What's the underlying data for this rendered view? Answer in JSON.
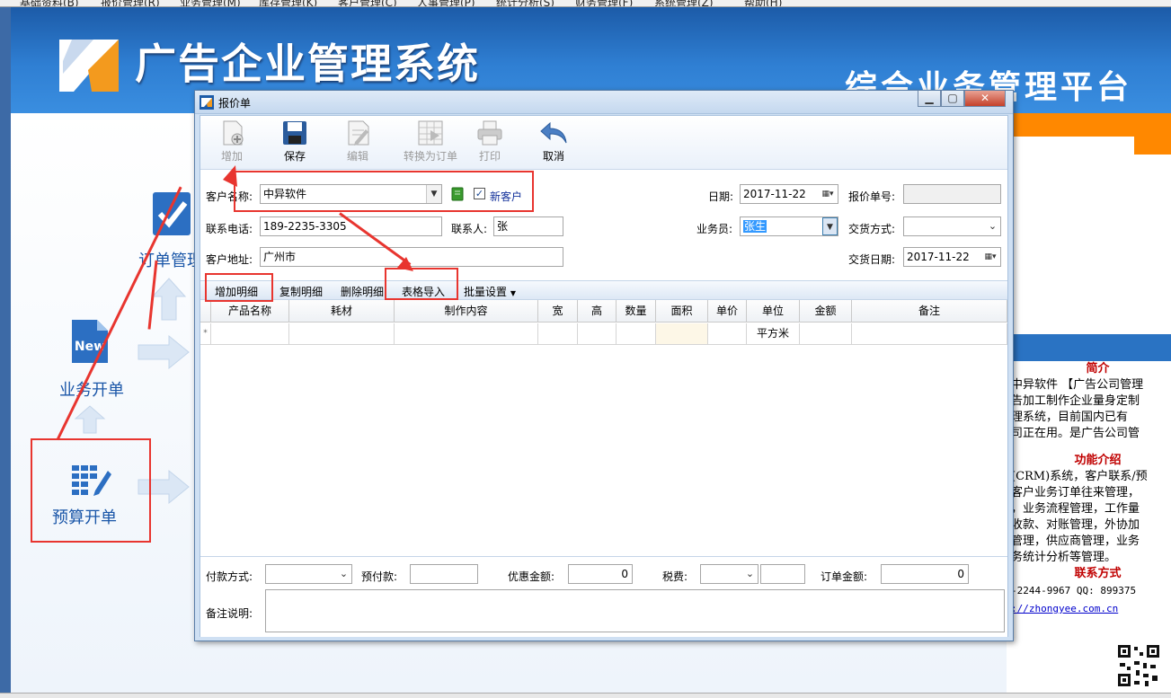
{
  "menu": [
    "基础资料(B)",
    "报价管理(R)",
    "业务管理(M)",
    "库存管理(K)",
    "客户管理(C)",
    "人事管理(P)",
    "统计分析(S)",
    "财务管理(F)",
    "系统管理(Z)",
    "帮助(H)"
  ],
  "banner": {
    "title": "广告企业管理系统",
    "subtitle": "综合业务管理平台"
  },
  "flow": {
    "order_label": "订单管理",
    "business_label": "业务开单",
    "budget_label": "预算开单",
    "new_badge": "New"
  },
  "right_panel": {
    "intro_heading": "简介",
    "intro_lines": [
      "中异软件 【广告公司管理",
      "告加工制作企业量身定制",
      "理系统，目前国内已有",
      "司正在用。是广告公司管"
    ],
    "func_heading": "功能介绍",
    "func_lines": [
      "(CRM)系统，客户联系/预",
      "客户业务订单往来管理，",
      "，业务流程管理，工作量",
      "收款、对账管理，外协加",
      "管理，供应商管理，业务",
      "务统计分析等管理。"
    ],
    "contact_heading": "联系方式",
    "contact_lines": [
      "-2244-9967  QQ: 899375",
      "://zhongyee.com.cn"
    ]
  },
  "dialog": {
    "title": "报价单",
    "toolbar": {
      "add": "增加",
      "save": "保存",
      "edit": "编辑",
      "convert": "转换为订单",
      "print": "打印",
      "cancel": "取消"
    },
    "form": {
      "customer_name_label": "客户名称:",
      "customer_name": "中异软件",
      "new_customer_label": "新客户",
      "new_customer_checked": true,
      "phone_label": "联系电话:",
      "phone": "189-2235-3305",
      "contact_label": "联系人:",
      "contact": "张",
      "address_label": "客户地址:",
      "address": "广州市",
      "date_label": "日期:",
      "date": "2017-11-22",
      "quote_no_label": "报价单号:",
      "quote_no": "",
      "salesman_label": "业务员:",
      "salesman": "张生",
      "delivery_method_label": "交货方式:",
      "delivery_method": "",
      "delivery_date_label": "交货日期:",
      "delivery_date": "2017-11-22"
    },
    "tabs": {
      "add_detail": "增加明细",
      "copy_detail": "复制明细",
      "delete_detail": "删除明细",
      "table_import": "表格导入",
      "batch_settings": "批量设置"
    },
    "grid": {
      "columns": [
        "产品名称",
        "耗材",
        "制作内容",
        "宽",
        "高",
        "数量",
        "面积",
        "单价",
        "单位",
        "金额",
        "备注"
      ],
      "new_row_marker": "*",
      "new_row_unit": "平方米"
    },
    "footer": {
      "payment_method_label": "付款方式:",
      "payment_method": "",
      "prepayment_label": "预付款:",
      "prepayment": "",
      "discount_label": "优惠金额:",
      "discount": "0",
      "tax_label": "税费:",
      "tax": "",
      "order_amount_label": "订单金额:",
      "order_amount": "0",
      "remark_label": "备注说明:",
      "remark": ""
    }
  },
  "colors": {
    "accent": "#e8352f",
    "banner_blue": "#2a73c3",
    "orange": "#ff8800"
  }
}
